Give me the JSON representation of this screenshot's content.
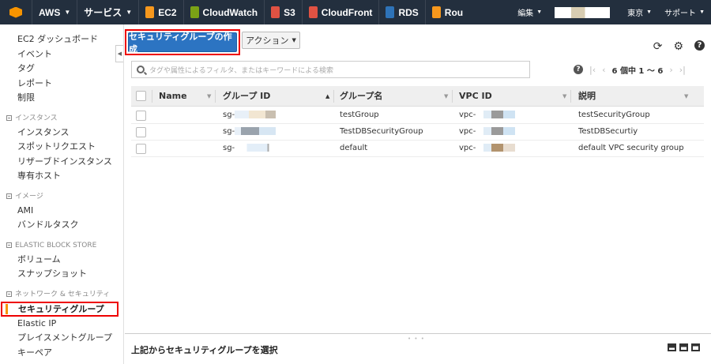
{
  "topnav": {
    "aws": "AWS",
    "services": "サービス",
    "links": [
      {
        "label": "EC2",
        "color": "#f7981d"
      },
      {
        "label": "CloudWatch",
        "color": "#7aa116"
      },
      {
        "label": "S3",
        "color": "#e05243"
      },
      {
        "label": "CloudFront",
        "color": "#e05243"
      },
      {
        "label": "RDS",
        "color": "#2e73b8"
      },
      {
        "label": "Rou",
        "color": "#f7981d"
      }
    ],
    "edit": "編集",
    "region": "東京",
    "support": "サポート"
  },
  "sidebar": {
    "top_items": [
      "EC2 ダッシュボード",
      "イベント",
      "タグ",
      "レポート",
      "制限"
    ],
    "sections": [
      {
        "title": "インスタンス",
        "items": [
          "インスタンス",
          "スポットリクエスト",
          "リザーブドインスタンス",
          "専有ホスト"
        ]
      },
      {
        "title": "イメージ",
        "items": [
          "AMI",
          "バンドルタスク"
        ]
      },
      {
        "title": "ELASTIC BLOCK STORE",
        "items": [
          "ボリューム",
          "スナップショット"
        ]
      },
      {
        "title": "ネットワーク & セキュリティ",
        "items": [
          "セキュリティグループ",
          "Elastic IP",
          "プレイスメントグループ",
          "キーペア"
        ]
      }
    ],
    "active": "セキュリティグループ"
  },
  "toolbar": {
    "create_label": "セキュリティグループの作成",
    "actions_label": "アクション"
  },
  "search": {
    "placeholder": "タグや属性によるフィルタ、またはキーワードによる検索"
  },
  "pager": {
    "text": "6 個中 1 ～ 6"
  },
  "table": {
    "columns": [
      "Name",
      "グループ ID",
      "グループ名",
      "VPC ID",
      "説明"
    ],
    "rows": [
      {
        "name": "",
        "group_id": "sg-",
        "group_name": "testGroup",
        "vpc_id": "vpc-",
        "description": "testSecurityGroup"
      },
      {
        "name": "",
        "group_id": "sg-",
        "group_name": "TestDBSecurityGroup",
        "vpc_id": "vpc-",
        "description": "TestDBSecurtiy"
      },
      {
        "name": "",
        "group_id": "sg-",
        "group_name": "default",
        "vpc_id": "vpc-",
        "description": "default VPC security group"
      }
    ]
  },
  "bottom": {
    "text": "上記からセキュリティグループを選択"
  }
}
